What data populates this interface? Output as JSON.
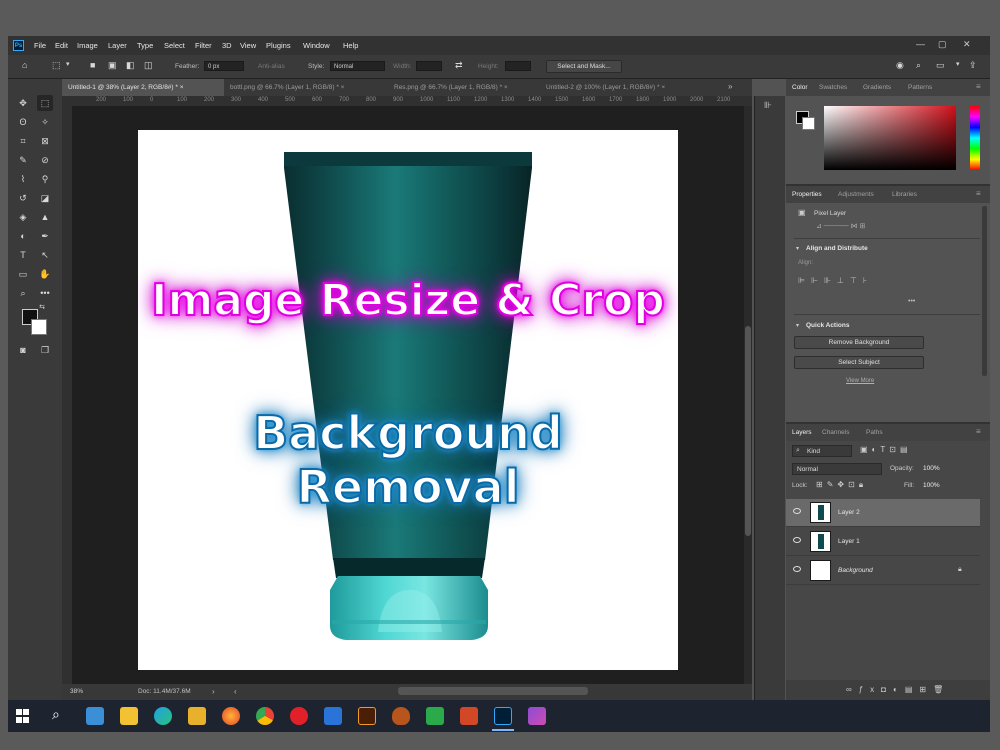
{
  "menubar": {
    "logo": "Ps",
    "items": [
      "File",
      "Edit",
      "Image",
      "Layer",
      "Type",
      "Select",
      "Filter",
      "3D",
      "View",
      "Plugins",
      "Window",
      "Help"
    ]
  },
  "options": {
    "feather_label": "Feather:",
    "feather_value": "0 px",
    "antialias_label": "Anti-alias",
    "style_label": "Style:",
    "style_value": "Normal",
    "width_label": "Width:",
    "height_label": "Height:",
    "select_mask_label": "Select and Mask..."
  },
  "tabs": [
    {
      "label": "Untitled-1 @ 38% (Layer 2, RGB/8#) *  ×",
      "active": true
    },
    {
      "label": "bottl.png @ 66.7% (Layer 1, RGB/8) *  ×",
      "active": false
    },
    {
      "label": "Res.png @ 66.7% (Layer 1, RGB/8) *  ×",
      "active": false
    },
    {
      "label": "Untitled-2 @ 100% (Layer 1, RGB/8#) *  ×",
      "active": false
    }
  ],
  "ruler": [
    "200",
    "100",
    "0",
    "100",
    "200",
    "300",
    "400",
    "500",
    "600",
    "700",
    "800",
    "900",
    "1000",
    "1100",
    "1200",
    "1300",
    "1400",
    "1500",
    "1600",
    "1700",
    "1800",
    "1900",
    "2000",
    "2100"
  ],
  "canvas": {
    "line1": "Image Resize & Crop",
    "line2": "Background Removal"
  },
  "status": {
    "zoom": "38%",
    "doc": "Doc: 11.4M/37.6M"
  },
  "color_panel": {
    "tabs": [
      "Color",
      "Swatches",
      "Gradients",
      "Patterns"
    ]
  },
  "properties_panel": {
    "tabs": [
      "Properties",
      "Adjustments",
      "Libraries"
    ],
    "pixel_layer": "Pixel Layer",
    "align_title": "Align and Distribute",
    "align_label": "Align:",
    "quick_actions_title": "Quick Actions",
    "remove_bg": "Remove Background",
    "select_subject": "Select Subject",
    "view_more": "View More"
  },
  "layers_panel": {
    "tabs": [
      "Layers",
      "Channels",
      "Paths"
    ],
    "kind": "Kind",
    "blend_mode": "Normal",
    "opacity_label": "Opacity:",
    "opacity_value": "100%",
    "lock_label": "Lock:",
    "fill_label": "Fill:",
    "fill_value": "100%",
    "layers": [
      {
        "name": "Layer 2",
        "selected": true
      },
      {
        "name": "Layer 1",
        "selected": false
      },
      {
        "name": "Background",
        "selected": false
      }
    ]
  },
  "colors": {
    "app_bg": "#535353",
    "promo1_glow": "#e000e0",
    "promo2_glow": "#1a80c0",
    "tube": "#0f4a4c",
    "cap": "#3fc1c0"
  },
  "taskbar_icons": [
    "windows-icon",
    "search-icon",
    "app-icon",
    "explorer-icon",
    "edge-icon",
    "folder-icon",
    "firefox-icon",
    "chrome-icon",
    "opera-icon",
    "mail-icon",
    "illustrator-icon",
    "shield-icon",
    "camtasia-icon",
    "powerpoint-icon",
    "photoshop-icon",
    "app2-icon"
  ]
}
